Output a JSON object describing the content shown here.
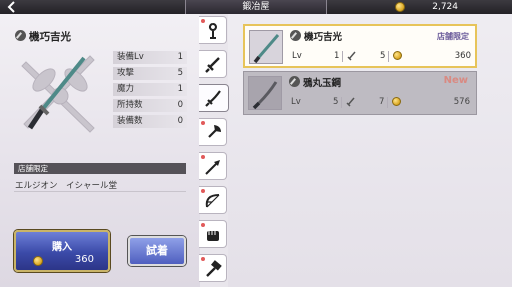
{
  "header": {
    "back_icon": "back-arrow-icon",
    "title": "鍛冶屋",
    "gold": "2,724"
  },
  "detail": {
    "name": "機巧吉光",
    "stats": [
      {
        "label": "装備Lv",
        "value": "1"
      },
      {
        "label": "攻撃",
        "value": "5"
      },
      {
        "label": "魔力",
        "value": "1"
      },
      {
        "label": "所持数",
        "value": "0"
      },
      {
        "label": "装備数",
        "value": "0"
      }
    ],
    "shop_limited_label": "店舗限定",
    "shop_desc": "エルジオン　イシャール堂"
  },
  "buttons": {
    "buy_label": "購入",
    "buy_price": "360",
    "try_label": "試着"
  },
  "tabs": [
    {
      "icon": "accessory-icon"
    },
    {
      "icon": "sword-icon"
    },
    {
      "icon": "katana-icon",
      "active": true
    },
    {
      "icon": "axe-icon"
    },
    {
      "icon": "spear-icon"
    },
    {
      "icon": "bow-icon"
    },
    {
      "icon": "fist-icon"
    },
    {
      "icon": "hammer-icon"
    }
  ],
  "list": [
    {
      "name": "機巧吉光",
      "tag": "店舗限定",
      "lv_label": "Lv",
      "lv": "1",
      "own": "5",
      "price": "360",
      "selected": true
    },
    {
      "name": "鴉丸玉鋼",
      "tag": "New",
      "lv_label": "Lv",
      "lv": "5",
      "own": "7",
      "price": "576",
      "disabled": true
    }
  ],
  "colors": {
    "accent_gold": "#e7c45a",
    "buy_button": "#3b4aa8",
    "new_tag": "#d98a82"
  }
}
